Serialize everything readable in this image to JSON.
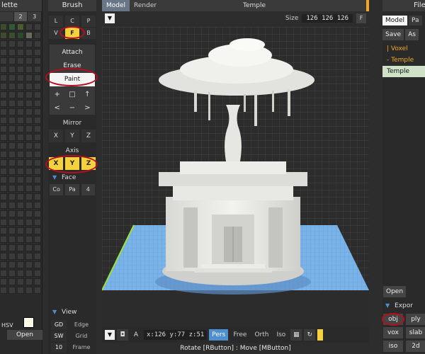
{
  "palette": {
    "title": "lette",
    "tabs": [
      "",
      "2",
      "3"
    ],
    "hsv_label": "HSV",
    "open_label": "Open",
    "swatch_color": "#fffde4"
  },
  "brush": {
    "title": "Brush",
    "modes": [
      "L",
      "C",
      "P",
      "V",
      "F",
      "B"
    ],
    "selected_mode": "F",
    "tools": [
      "Attach",
      "Erase",
      "Paint"
    ],
    "selected_tool": "Paint",
    "symbols": [
      "+",
      "□",
      "↑",
      "<",
      "−",
      ">"
    ],
    "mirror_label": "Mirror",
    "mirror": [
      "X",
      "Y",
      "Z"
    ],
    "axis_label": "Axis",
    "axis": [
      "X",
      "Y",
      "Z"
    ],
    "face_label": "Face",
    "face": [
      "Co",
      "Pa",
      "4"
    ],
    "view_label": "View",
    "view_rows": [
      {
        "key": "GD",
        "value": "Edge"
      },
      {
        "key": "SW",
        "value": "Grid"
      },
      {
        "key": "10",
        "value": "Frame"
      }
    ]
  },
  "main": {
    "tabs": [
      "Model",
      "Render"
    ],
    "active_tab": "Model",
    "title": "Temple",
    "size_label": "Size",
    "size_value": "126 126 126",
    "f_label": "F",
    "coords": "x:126 y:77  z:51",
    "projections": [
      "Pers",
      "Free",
      "Orth",
      "Iso"
    ],
    "active_projection": "Pers",
    "a_label": "A",
    "status": "Rotate [RButton] : Move [MButton]"
  },
  "file": {
    "title": "File",
    "tabs": [
      "Model",
      "Pa"
    ],
    "actions": [
      "Save",
      "As"
    ],
    "items": [
      {
        "label": "| Voxel",
        "style": "orange"
      },
      {
        "label": "- Temple",
        "style": "orange"
      },
      {
        "label": "Temple",
        "style": "sel"
      }
    ],
    "open_label": "Open",
    "export_label": "Expor",
    "formats": [
      "obj",
      "ply",
      "vox",
      "slab",
      "iso",
      "2d"
    ]
  },
  "colors": {
    "accent_yellow": "#f5d13e",
    "tab_blue": "#6a7687",
    "pers_blue": "#4d8fd1",
    "floor_blue": "#7ab3e8",
    "annotation_red": "#b30f1e",
    "orange": "#f5a623"
  }
}
